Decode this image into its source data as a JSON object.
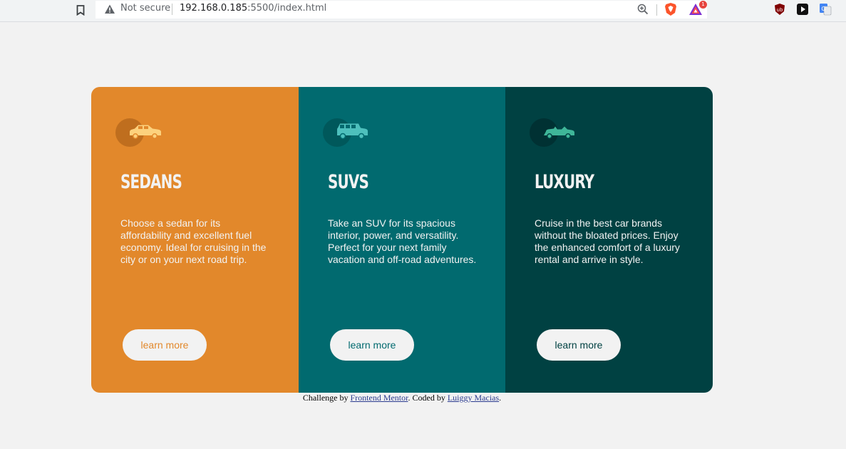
{
  "browser": {
    "security_label": "Not secure",
    "url_host": "192.168.0.185",
    "url_rest": ":5500/index.html",
    "rewards_badge": "1",
    "icons": [
      "bookmark-icon",
      "warning-icon",
      "zoom-icon",
      "brave-shield-icon",
      "brave-rewards-icon",
      "ublock-icon",
      "play-icon",
      "translate-icon"
    ]
  },
  "cards": [
    {
      "icon": "sedan-car-icon",
      "title": "SEDANS",
      "text": "Choose a sedan for its affordability and excellent fuel economy. Ideal for cruising in the city or on your next road trip.",
      "button": "learn more",
      "color": "#e2882b"
    },
    {
      "icon": "suv-car-icon",
      "title": "SUVS",
      "text": "Take an SUV for its spacious interior, power, and versatility. Perfect for your next family vacation and off-road adventures.",
      "button": "learn more",
      "color": "#016a6f"
    },
    {
      "icon": "luxury-car-icon",
      "title": "LUXURY",
      "text": "Cruise in the best car brands without the bloated prices. Enjoy the enhanced comfort of a luxury rental and arrive in style.",
      "button": "learn more",
      "color": "#004142"
    }
  ],
  "attribution": {
    "prefix": "Challenge by ",
    "link1": "Frontend Mentor",
    "middle": ". Coded by ",
    "link2": "Luiggy Macias",
    "suffix": "."
  },
  "colors": {
    "background": "#f2f2f2",
    "text_light": "#f2f2f2"
  }
}
